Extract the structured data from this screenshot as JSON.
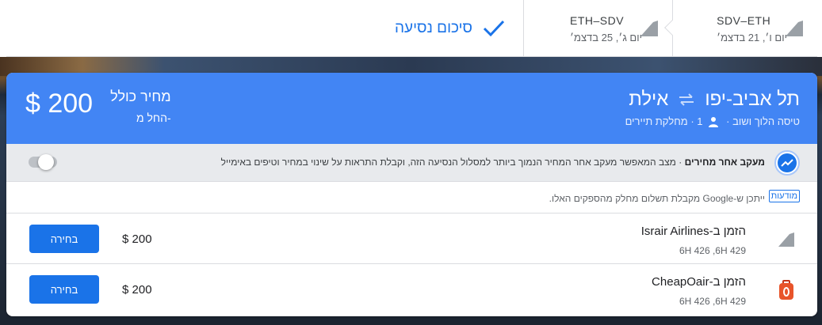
{
  "summary_bar": {
    "legs": [
      {
        "route": "SDV–ETH",
        "date": "יום ו׳, 21 בדצמ׳"
      },
      {
        "route": "ETH–SDV",
        "date": "יום ג׳, 25 בדצמ׳"
      }
    ],
    "summary_label": "סיכום נסיעה"
  },
  "trip": {
    "from": "תל אביב-יפו",
    "to": "אילת",
    "meta": {
      "trip_type": "טיסה הלוך ושוב",
      "passengers": "1",
      "cabin": "מחלקת תיירים"
    },
    "price": "$ 200",
    "price_total_label": "מחיר כולל",
    "price_from_label": "החל מ-"
  },
  "price_tracking": {
    "label": "מעקב אחר מחירים",
    "description": "· מצב המאפשר מעקב אחר המחיר הנמוך ביותר למסלול הנסיעה הזה, וקבלת התראות על שינוי במחיר וטיפים באימייל",
    "enabled": false
  },
  "notice": {
    "ads_label": "מודעות",
    "text": "ייתכן ש-Google מקבלת תשלום מחלק מהספקים האלו."
  },
  "booking_options": [
    {
      "title": "הזמן ב-Israir Airlines",
      "codes": "6H 426 ,6H 429",
      "price": "$ 200",
      "button": "בחירה",
      "icon": "plane-tail-icon"
    },
    {
      "title": "הזמן ב-CheapOair",
      "codes": "6H 426 ,6H 429",
      "price": "$ 200",
      "button": "בחירה",
      "icon": "cheapoair-logo"
    }
  ],
  "colors": {
    "accent": "#1a73e8",
    "header_bg": "#4285f4",
    "track_bg": "#e8eaed"
  }
}
